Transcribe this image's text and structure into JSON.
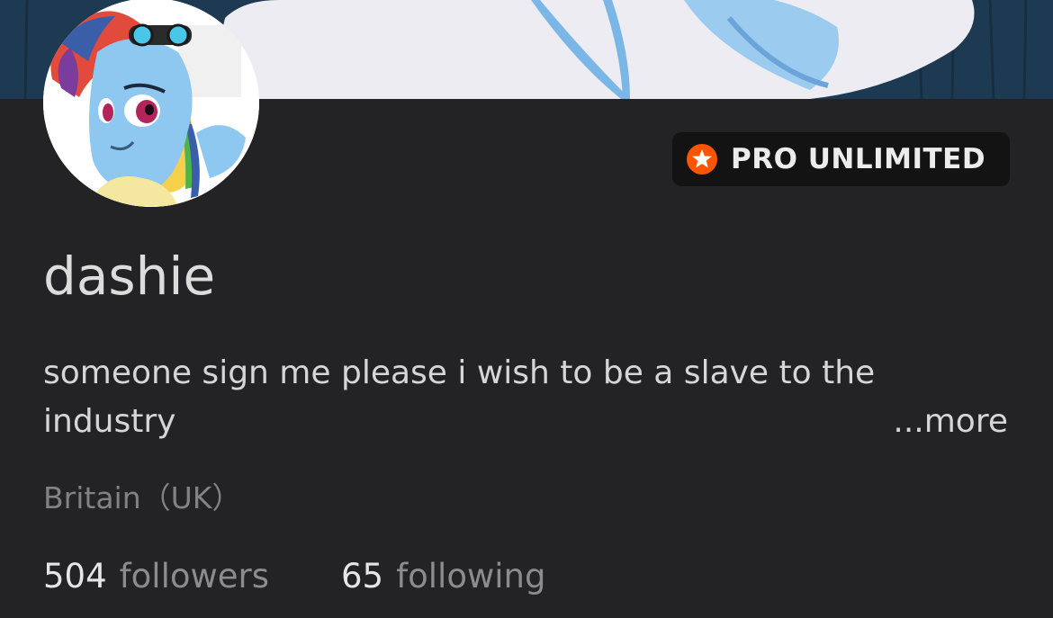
{
  "profile": {
    "username": "dashie",
    "bio_line1": "someone sign me please i wish to be a slave to the",
    "bio_line2": "industry",
    "more_label": "...more",
    "location": "Britain（UK）"
  },
  "badge": {
    "label": "PRO UNLIMITED",
    "icon": "star-icon",
    "accent_color": "#ff5500"
  },
  "stats": {
    "followers_count": "504",
    "followers_label": "followers",
    "following_count": "65",
    "following_label": "following"
  },
  "colors": {
    "background": "#232224",
    "badge_background": "#141314",
    "text_primary": "#dcdcdc",
    "text_muted": "#828282"
  }
}
